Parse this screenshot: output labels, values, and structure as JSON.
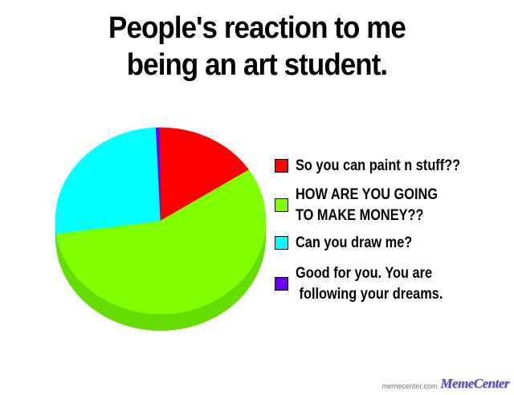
{
  "title_lines": [
    "People's reaction to me",
    "being an art student."
  ],
  "chart_data": {
    "type": "pie",
    "title": "People's reaction to me being an art student.",
    "slices": [
      {
        "label_lines": [
          "So you can paint n stuff??"
        ],
        "value": 16,
        "color": "#ff0000",
        "side_color": "#d90000"
      },
      {
        "label_lines": [
          "HOW ARE YOU GOING",
          "TO MAKE MONEY??"
        ],
        "value": 57,
        "color": "#80ff00",
        "side_color": "#66dd00"
      },
      {
        "label_lines": [
          "Can you draw me?"
        ],
        "value": 26.5,
        "color": "#00ffff",
        "side_color": "#00d4d4"
      },
      {
        "label_lines": [
          "Good for you. You are",
          " following your dreams."
        ],
        "value": 0.5,
        "color": "#6600ff",
        "side_color": "#5000cc"
      }
    ],
    "legend_position": "right"
  },
  "watermark": {
    "url": "memecenter.com",
    "logo": "MemeCenter"
  }
}
